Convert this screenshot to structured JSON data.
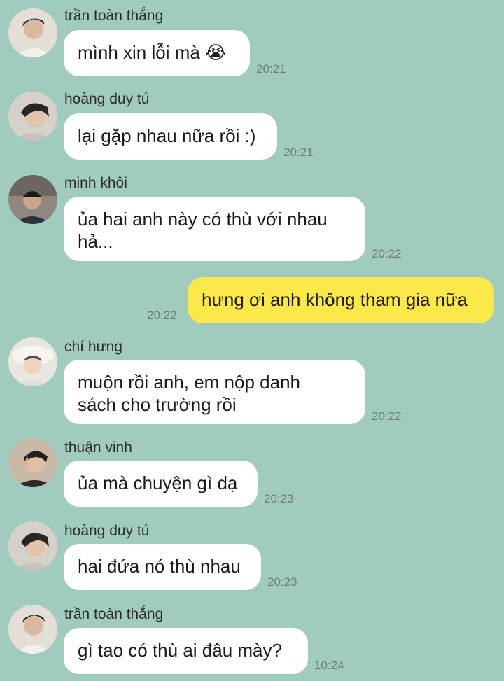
{
  "messages": [
    {
      "sender": "trần toàn thắng",
      "text": "mình xin lỗi mà 😭",
      "time": "20:21",
      "avatar": "avatar-icon"
    },
    {
      "sender": "hoàng duy tú",
      "text": "lại gặp nhau nữa rồi :)",
      "time": "20:21",
      "avatar": "avatar-icon"
    },
    {
      "sender": "minh khôi",
      "text": "ủa hai anh này có thù với nhau\nhả...",
      "time": "20:22",
      "avatar": "avatar-icon"
    },
    {
      "sender": "",
      "text": "hưng ơi anh không tham gia nữa",
      "time": "20:22",
      "mine": true
    },
    {
      "sender": "chí hưng",
      "text": "muộn rồi anh, em nộp danh\nsách cho trường rồi",
      "time": "20:22",
      "avatar": "avatar-icon"
    },
    {
      "sender": "thuận vinh",
      "text": "ủa mà chuyện gì dạ",
      "time": "20:23",
      "avatar": "avatar-icon"
    },
    {
      "sender": "hoàng duy tú",
      "text": "hai đứa nó thù nhau",
      "time": "20:23",
      "avatar": "avatar-icon"
    },
    {
      "sender": "trần toàn thắng",
      "text": "gì tao có thù ai đâu mày?",
      "time": "10:24",
      "avatar": "avatar-icon"
    }
  ],
  "colors": {
    "background": "#a1cbbf",
    "incoming": "#ffffff",
    "outgoing": "#fde84a"
  }
}
